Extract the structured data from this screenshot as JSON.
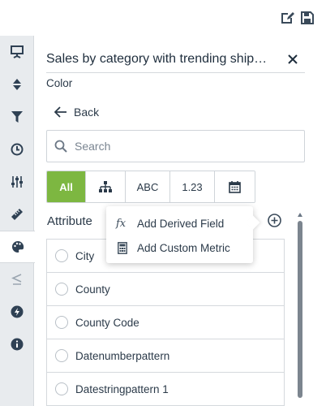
{
  "toolbar": {
    "icons": [
      "edit-export-icon",
      "save-icon"
    ]
  },
  "left_rail": {
    "items": [
      {
        "icon": "presentation-icon"
      },
      {
        "icon": "sort-icon"
      },
      {
        "icon": "filter-icon"
      },
      {
        "icon": "clock-icon"
      },
      {
        "icon": "sliders-icon"
      },
      {
        "icon": "ruler-icon"
      },
      {
        "icon": "palette-icon",
        "active": true
      },
      {
        "icon": "less-equal-icon"
      },
      {
        "icon": "lightning-icon"
      },
      {
        "icon": "info-icon"
      }
    ]
  },
  "panel": {
    "title": "Sales by category with trending ship…",
    "subtitle": "Color",
    "back_label": "Back",
    "search_placeholder": "Search",
    "filters": [
      {
        "label": "All",
        "active": true
      },
      {
        "icon": "hierarchy-icon"
      },
      {
        "label": "ABC"
      },
      {
        "label": "1.23"
      },
      {
        "icon": "calendar-icon"
      }
    ],
    "section_label": "Attribute",
    "attributes": [
      "City",
      "County",
      "County Code",
      "Datenumberpattern",
      "Datestringpattern 1"
    ]
  },
  "popup_menu": {
    "items": [
      {
        "icon_text": "fx",
        "label": "Add Derived Field"
      },
      {
        "icon": "calculator-icon",
        "label": "Add Custom Metric"
      }
    ]
  },
  "colors": {
    "accent_green": "#7db741",
    "rail_bg": "#e8ebee",
    "text": "#2b3a49"
  }
}
